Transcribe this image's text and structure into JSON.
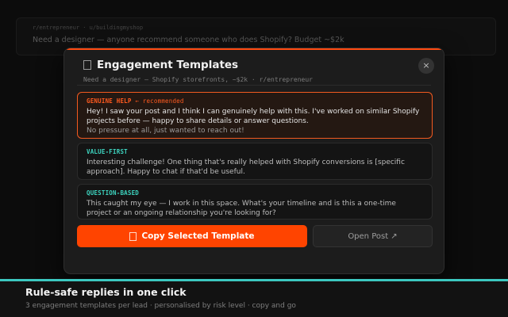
{
  "background_lead": {
    "meta": "r/entrepreneur · u/buildingmyshop",
    "text": "Need a designer — anyone recommend someone who does Shopify? Budget ~$2k"
  },
  "modal": {
    "icon": "clipboard-icon",
    "title": "Engagement Templates",
    "subtitle": "Need a designer – Shopify storefronts, ~$2k · r/entrepreneur",
    "close_label": "×",
    "templates": [
      {
        "label": "GENUINE HELP",
        "tag": "← recommended",
        "body": "Hey! I saw your post and I think I can genuinely help with this. I've worked on similar Shopify projects before — happy to share details or answer questions.",
        "body_muted": "No pressure at all, just wanted to reach out!",
        "selected": true
      },
      {
        "label": "VALUE-FIRST",
        "body": "Interesting challenge! One thing that's really helped with Shopify conversions is [specific approach]. Happy to chat if that'd be useful.",
        "selected": false
      },
      {
        "label": "QUESTION-BASED",
        "body": "This caught my eye — I work in this space. What's your timeline and is this a one-time project or an ongoing relationship you're looking for?",
        "selected": false
      }
    ],
    "copy_button": "Copy Selected Template",
    "open_button": "Open Post ↗"
  },
  "banner": {
    "title": "Rule-safe replies in one click",
    "subtitle": "3 engagement templates per lead · personalised by risk level · copy and go"
  },
  "colors": {
    "accent_orange": "#ff4400",
    "accent_teal": "#3dd5c0",
    "background": "#0c0c0c"
  }
}
